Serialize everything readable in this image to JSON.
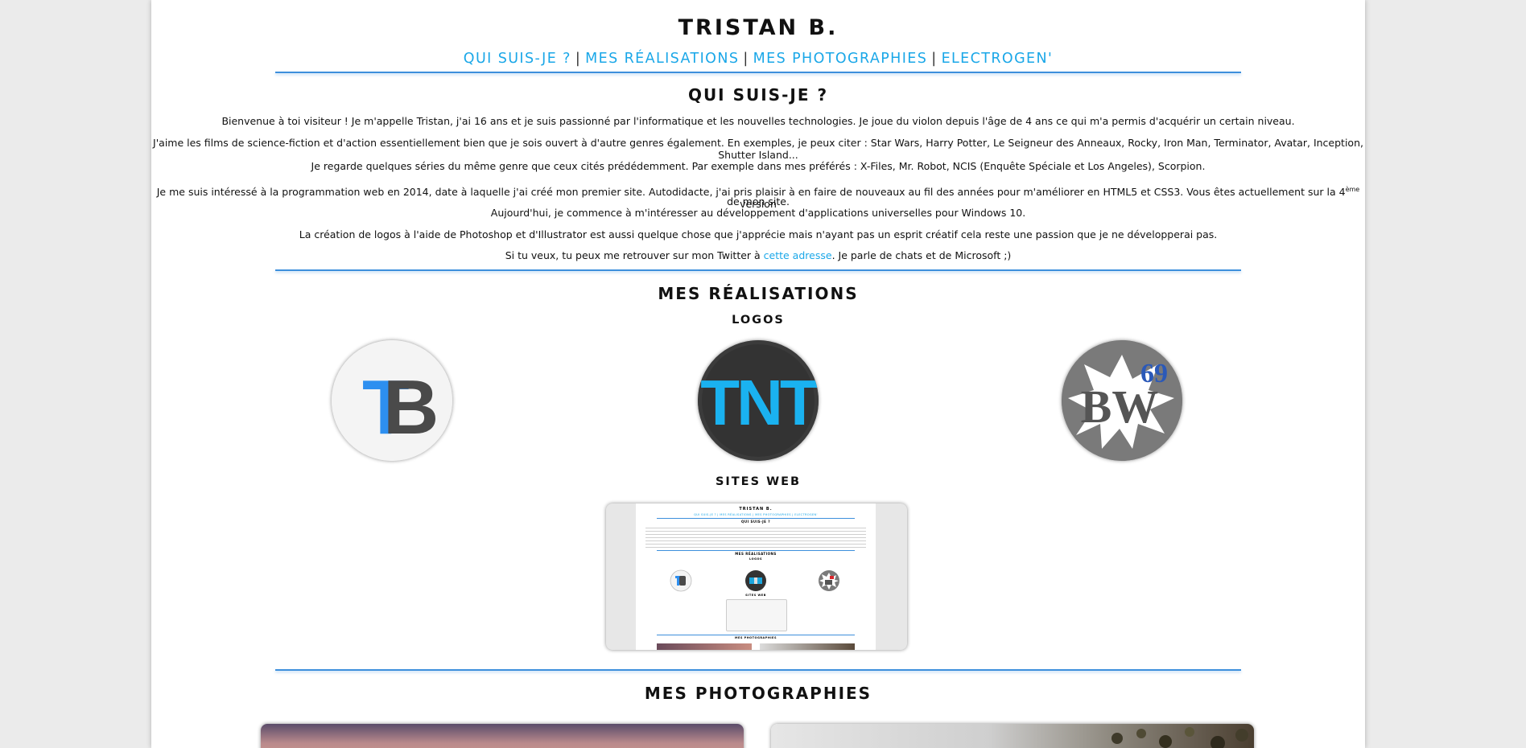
{
  "header": {
    "title": "TRISTAN B.",
    "nav": [
      {
        "label": "QUI SUIS-JE ?"
      },
      {
        "label": "MES RÉALISATIONS"
      },
      {
        "label": "MES PHOTOGRAPHIES"
      },
      {
        "label": "ELECTROGEN'"
      }
    ],
    "separator": "|"
  },
  "about": {
    "heading": "QUI SUIS-JE ?",
    "p1": "Bienvenue à toi visiteur ! Je m'appelle Tristan, j'ai 16 ans et je suis passionné par l'informatique et les nouvelles technologies. Je joue du violon depuis l'âge de 4 ans ce qui m'a permis d'acquérir un certain niveau.",
    "p2_line1": "J'aime les films de science-fiction et d'action essentiellement bien que je sois ouvert à d'autre genres également. En exemples, je peux citer : Star Wars, Harry Potter, Le Seigneur des Anneaux, Rocky, Iron Man, Terminator, Avatar, Inception,",
    "p2_line2": "Shutter Island...",
    "p2_line3": "Je regarde quelques séries du même genre que ceux cités prédédemment. Par exemple dans mes préférés : X-Files, Mr. Robot, NCIS (Enquête Spéciale et Los Angeles), Scorpion.",
    "p3_line1_a": "Je me suis intéressé à la programmation web en 2014, date à laquelle j'ai créé mon premier site. Autodidacte, j'ai pris plaisir à en faire de nouveaux au fil des années pour m'améliorer en HTML5 et CSS3. Vous êtes actuellement sur la 4",
    "p3_sup": "ème",
    "p3_line1_b": " version",
    "p3_line2": "de mon site.",
    "p3_line3": "Aujourd'hui, je commence à m'intéresser au développement d'applications universelles pour Windows 10.",
    "p4": "La création de logos à l'aide de Photoshop et d'Illustrator est aussi quelque chose que j'apprécie mais n'ayant pas un esprit créatif cela reste une passion que je ne développerai pas.",
    "p5_before": "Si tu veux, tu peux me retrouver sur mon Twitter à ",
    "p5_link": "cette adresse",
    "p5_after": ". Je parle de chats et de Microsoft ;)"
  },
  "realisations": {
    "heading": "MES RÉALISATIONS",
    "logos_heading": "LOGOS",
    "logo_tb": {
      "text1": "T",
      "text2": "B"
    },
    "logo_tnt": {
      "text": "TNT"
    },
    "logo_bw": {
      "text": "BW",
      "number": "69"
    },
    "sites_heading": "SITES WEB",
    "thumb": {
      "title": "TRISTAN B.",
      "nav": "QUI SUIS-JE ? | MES RÉALISATIONS | MES PHOTOGRAPHIES | ELECTROGEN'",
      "h1": "QUI SUIS-JE ?",
      "h2": "MES RÉALISATIONS",
      "h3": "LOGOS",
      "h4": "SITES WEB",
      "h5": "MES PHOTOGRAPHIES"
    }
  },
  "photos": {
    "heading": "MES PHOTOGRAPHIES"
  },
  "colors": {
    "accent": "#1aa7e8",
    "rule": "#3d8fdc",
    "tb_blue": "#2d8ff0",
    "tb_gray": "#4a4a4a",
    "tnt_blue": "#1ab2f0",
    "bw_red": "#d8262c",
    "bw_blue": "#2b59b8"
  }
}
